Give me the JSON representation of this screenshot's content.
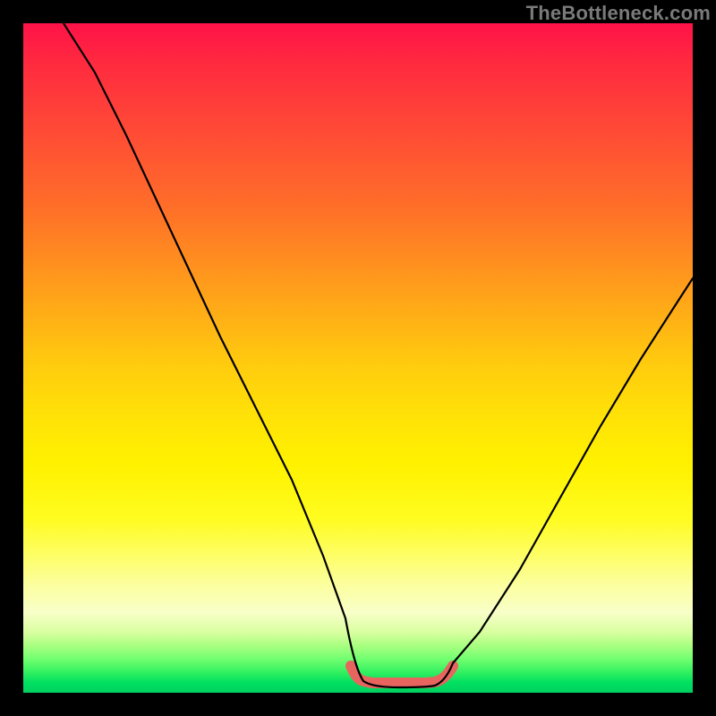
{
  "watermark": "TheBottleneck.com",
  "colors": {
    "frame": "#000000",
    "curve": "#000000",
    "floor_highlight": "#e8655f",
    "gradient_top": "#ff1248",
    "gradient_bottom": "#00d060"
  },
  "chart_data": {
    "type": "line",
    "title": "",
    "xlabel": "",
    "ylabel": "",
    "xlim": [
      0,
      100
    ],
    "ylim": [
      0,
      100
    ],
    "grid": false,
    "legend": false,
    "series": [
      {
        "name": "v-curve",
        "x": [
          6,
          10,
          15,
          20,
          25,
          30,
          35,
          40,
          45,
          48,
          50,
          53,
          56,
          59,
          62,
          64,
          68,
          74,
          80,
          86,
          92,
          98,
          100
        ],
        "values": [
          100,
          92,
          83,
          73,
          63,
          53,
          43,
          32,
          20,
          11,
          4,
          0,
          0,
          0,
          0,
          2,
          8,
          18,
          29,
          40,
          50,
          59,
          62
        ]
      }
    ],
    "annotations": [
      {
        "name": "floor-highlight",
        "x": [
          49,
          50,
          52,
          55,
          58,
          61,
          63,
          64
        ],
        "values": [
          4,
          2,
          0,
          0,
          0,
          0,
          2,
          4
        ]
      }
    ]
  }
}
